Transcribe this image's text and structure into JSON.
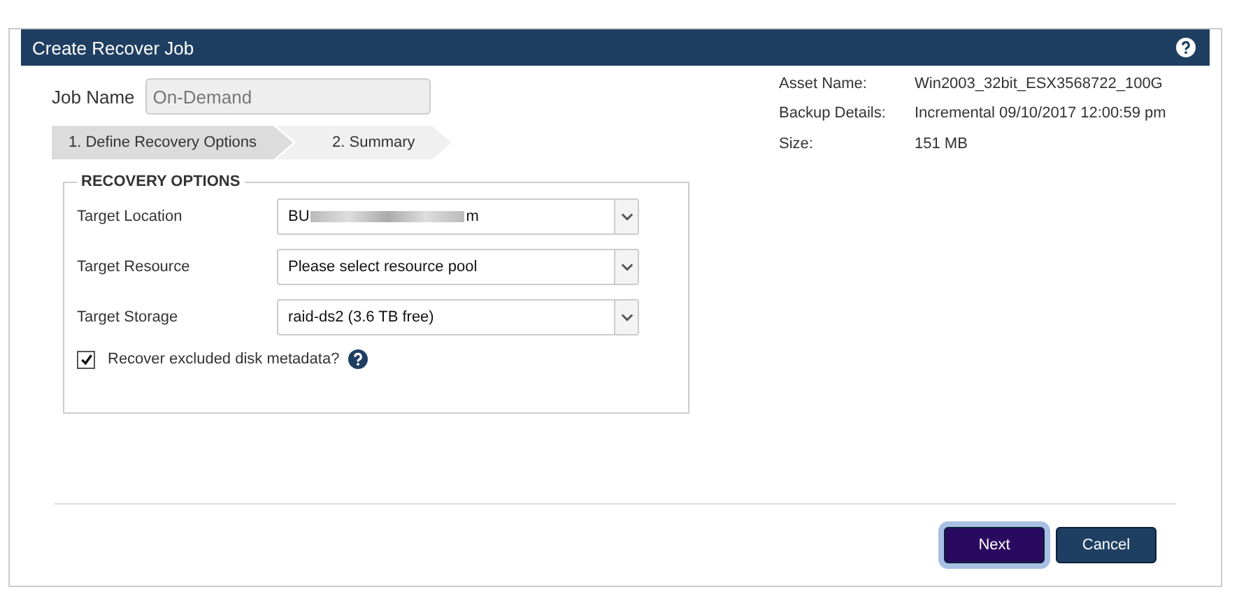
{
  "window": {
    "title": "Create Recover Job"
  },
  "job_name": {
    "label": "Job Name",
    "value": "On-Demand"
  },
  "steps": [
    {
      "label": "1. Define Recovery Options",
      "selected": true
    },
    {
      "label": "2. Summary",
      "selected": false
    }
  ],
  "details": [
    {
      "label": "Asset Name:",
      "value": "Win2003_32bit_ESX3568722_100G"
    },
    {
      "label": "Backup Details:",
      "value": "Incremental 09/10/2017 12:00:59 pm"
    },
    {
      "label": "Size:",
      "value": "151 MB"
    }
  ],
  "recovery_options": {
    "title": "RECOVERY OPTIONS",
    "fields": [
      {
        "label": "Target Location",
        "value_start": "BU",
        "value_end": "m",
        "redacted": true
      },
      {
        "label": "Target Resource",
        "value_start": "Please select resource pool"
      },
      {
        "label": "Target Storage",
        "value_start": "raid-ds2 (3.6 TB free)"
      }
    ],
    "checkbox": {
      "label": "Recover excluded disk metadata?",
      "checked": true
    }
  },
  "buttons": [
    {
      "label": "Next",
      "kind": "primary",
      "focused": true
    },
    {
      "label": "Cancel",
      "kind": "secondary",
      "focused": false
    }
  ]
}
